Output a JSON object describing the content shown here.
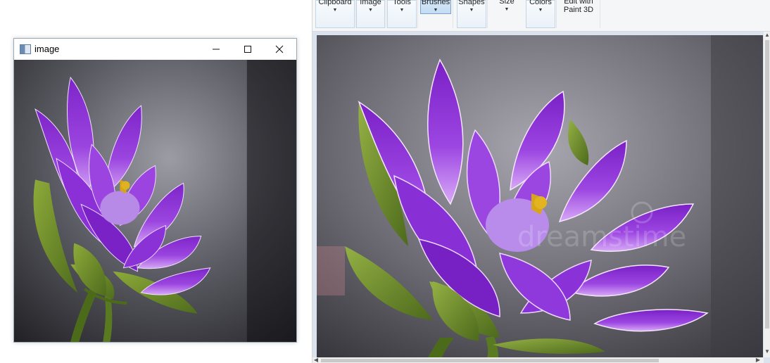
{
  "cv_window": {
    "title": "image",
    "controls": {
      "minimize": "minimize-icon",
      "maximize": "maximize-icon",
      "close": "close-icon"
    }
  },
  "paint": {
    "ribbon": {
      "groups": [
        {
          "label": "Clipboard"
        },
        {
          "label": "Image"
        },
        {
          "label": "Tools"
        },
        {
          "label": "Brushes",
          "active": true
        },
        {
          "label": "Shapes"
        },
        {
          "label": "Size"
        },
        {
          "label": "Colors"
        },
        {
          "label": "Edit with",
          "label2": "Paint 3D"
        }
      ]
    },
    "watermark": "dreamstime"
  },
  "colors": {
    "petal_dark": "#6a17b8",
    "petal_mid": "#9a3fe0",
    "petal_light": "#c98cf2",
    "leaf": "#6f8f2a",
    "background_dark": "#3f3f46"
  }
}
